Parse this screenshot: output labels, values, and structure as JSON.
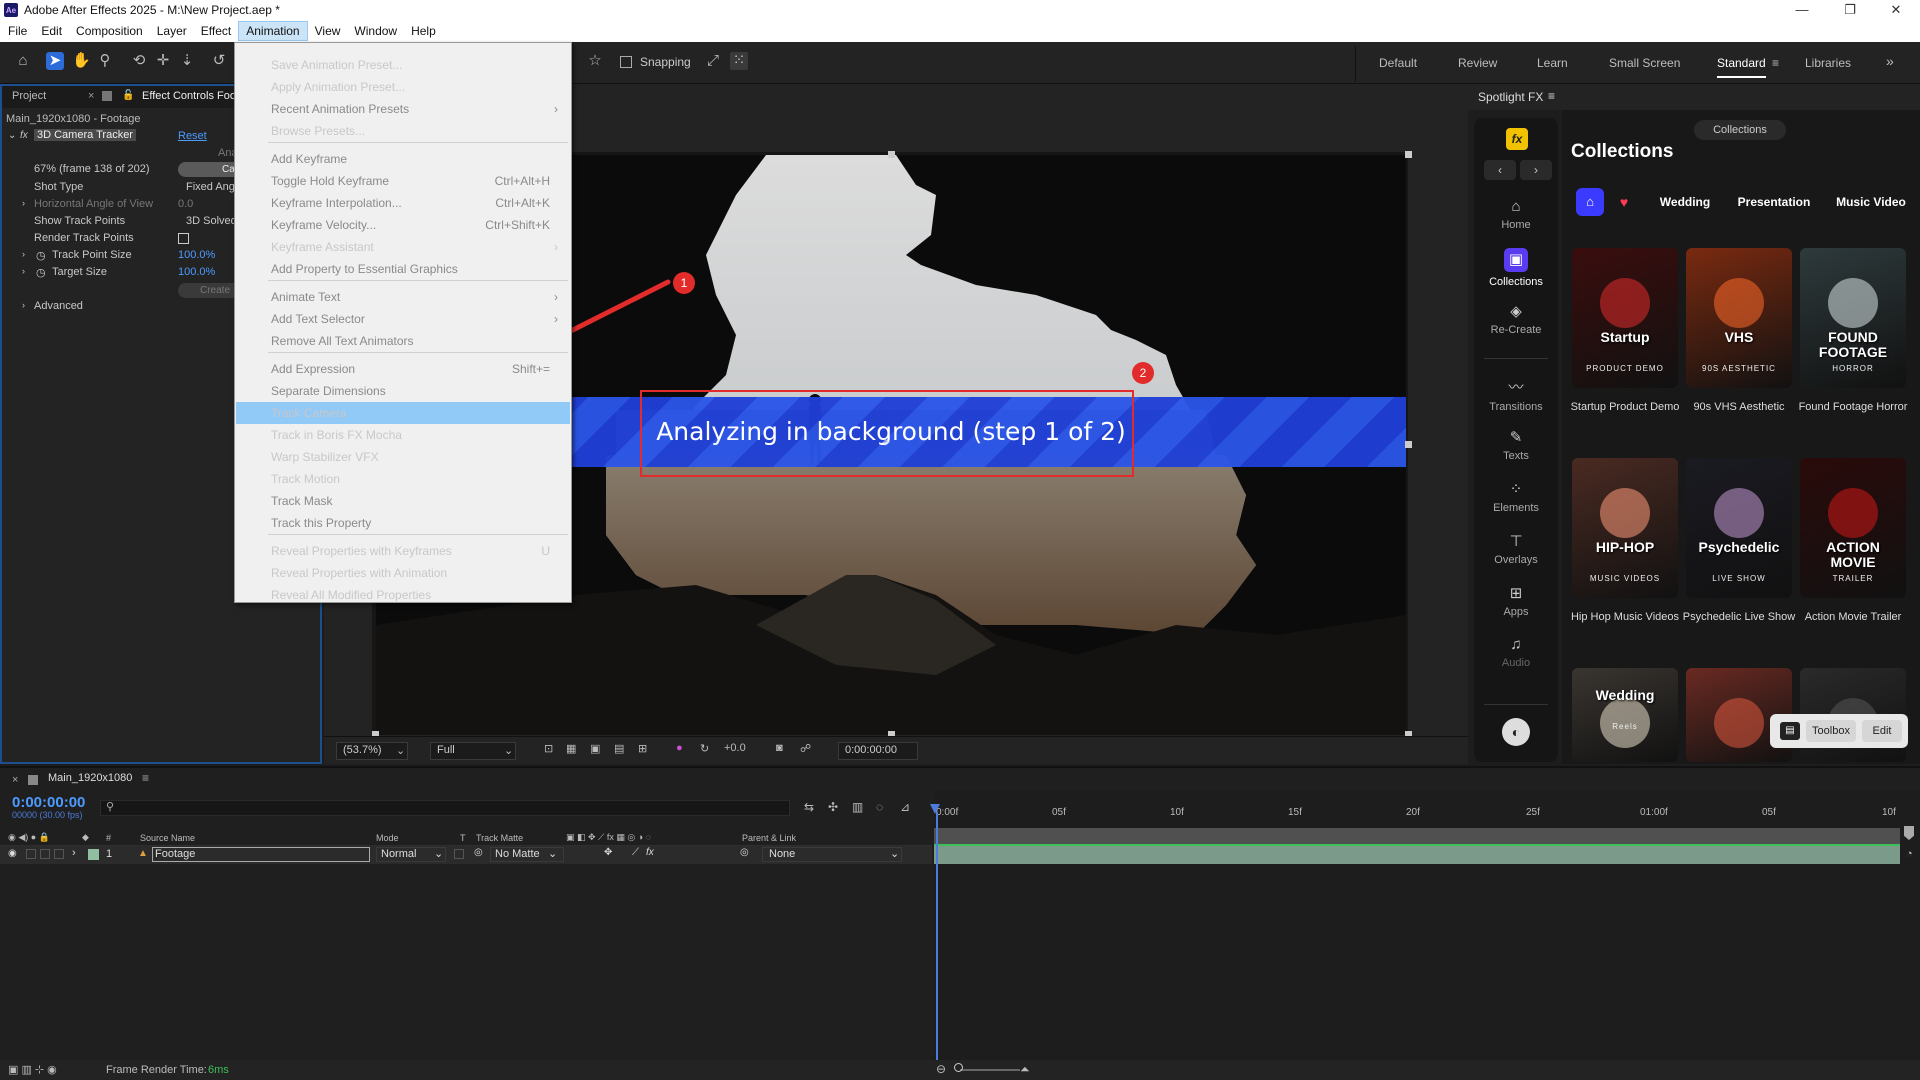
{
  "title_bar": {
    "logo": "Ae",
    "title": "Adobe After Effects 2025 - M:\\New Project.aep *",
    "minimize": "—",
    "maximize": "❐",
    "close": "✕"
  },
  "menubar": [
    "File",
    "Edit",
    "Composition",
    "Layer",
    "Effect",
    "Animation",
    "View",
    "Window",
    "Help"
  ],
  "toolbar": {
    "snapping_label": "Snapping"
  },
  "workspaces": [
    "Default",
    "Review",
    "Learn",
    "Small Screen",
    "Standard",
    "Libraries"
  ],
  "active_workspace": "Standard",
  "left_panel": {
    "tab_project": "Project",
    "tab_effect_controls": "Effect Controls Foot",
    "comp_layer": "Main_1920x1080 - Footage",
    "effect_name": "3D Camera Tracker",
    "reset_label": "Reset",
    "analyze_partial": "Ana",
    "cancel_partial": "Ca",
    "status_line": "67% (frame 138 of 202)",
    "shot_type_label": "Shot Type",
    "shot_type_value": "Fixed Ang",
    "hfov_label": "Horizontal Angle of View",
    "hfov_value": "0.0",
    "show_track_label": "Show Track Points",
    "show_track_value": "3D Solved",
    "render_track_label": "Render Track Points",
    "track_point_size_label": "Track Point Size",
    "track_point_size_value": "100.0%",
    "target_size_label": "Target Size",
    "target_size_value": "100.0%",
    "create_partial": "Create",
    "advanced_label": "Advanced"
  },
  "animation_menu": {
    "items": [
      {
        "label": "Save Animation Preset...",
        "disabled": false
      },
      {
        "label": "Apply Animation Preset...",
        "disabled": false
      },
      {
        "label": "Recent Animation Presets",
        "disabled": true,
        "submenu": true
      },
      {
        "label": "Browse Presets...",
        "disabled": false
      },
      {
        "label": "Add Keyframe",
        "disabled": true
      },
      {
        "label": "Toggle Hold Keyframe",
        "disabled": true,
        "shortcut": "Ctrl+Alt+H"
      },
      {
        "label": "Keyframe Interpolation...",
        "disabled": true,
        "shortcut": "Ctrl+Alt+K"
      },
      {
        "label": "Keyframe Velocity...",
        "disabled": true,
        "shortcut": "Ctrl+Shift+K"
      },
      {
        "label": "Keyframe Assistant",
        "disabled": false,
        "submenu": true
      },
      {
        "label": "Add Property to Essential Graphics",
        "disabled": true
      },
      {
        "label": "Animate Text",
        "disabled": true,
        "submenu": true
      },
      {
        "label": "Add Text Selector",
        "disabled": true,
        "submenu": true
      },
      {
        "label": "Remove All Text Animators",
        "disabled": true
      },
      {
        "label": "Add Expression",
        "disabled": true,
        "shortcut": "Shift+="
      },
      {
        "label": "Separate Dimensions",
        "disabled": true
      },
      {
        "label": "Track Camera",
        "disabled": false,
        "highlighted": true
      },
      {
        "label": "Track in Boris FX Mocha",
        "disabled": false
      },
      {
        "label": "Warp Stabilizer VFX",
        "disabled": false
      },
      {
        "label": "Track Motion",
        "disabled": false
      },
      {
        "label": "Track Mask",
        "disabled": true
      },
      {
        "label": "Track this Property",
        "disabled": true
      },
      {
        "label": "Reveal Properties with Keyframes",
        "disabled": false,
        "shortcut": "U"
      },
      {
        "label": "Reveal Properties with Animation",
        "disabled": false
      },
      {
        "label": "Reveal All Modified Properties",
        "disabled": false
      }
    ]
  },
  "viewer": {
    "banner_text": "Analyzing in background (step 1 of 2)",
    "zoom": "(53.7%)",
    "resolution": "Full",
    "exposure": "+0.0",
    "timecode": "0:00:00:00"
  },
  "annotations": [
    "1",
    "2"
  ],
  "spotlight": {
    "panel_title": "Spotlight FX",
    "fx_logo": "fx",
    "collections_tab": "Collections",
    "heading": "Collections",
    "sidebar": [
      {
        "label": "Home",
        "icon": "home-icon"
      },
      {
        "label": "Collections",
        "icon": "collections-icon",
        "active": true
      },
      {
        "label": "Re-Create",
        "icon": "layers-icon"
      },
      {
        "label": "Transitions",
        "icon": "transitions-icon"
      },
      {
        "label": "Texts",
        "icon": "pen-icon"
      },
      {
        "label": "Elements",
        "icon": "grid-icon"
      },
      {
        "label": "Overlays",
        "icon": "overlays-icon"
      },
      {
        "label": "Apps",
        "icon": "apps-icon"
      },
      {
        "label": "Audio",
        "icon": "music-icon"
      }
    ],
    "filters": [
      "Wedding",
      "Presentation",
      "Music Video"
    ],
    "cards": [
      {
        "label": "Startup Product Demo",
        "thumb_text": "Startup",
        "thumb_sub": "PRODUCT DEMO",
        "bg": "#3a0d0d",
        "accent": "#e02b2b"
      },
      {
        "label": "90s VHS Aesthetic",
        "thumb_text": "VHS",
        "thumb_sub": "90S AESTHETIC",
        "bg": "#7a2a10",
        "accent": "#ff6a2a"
      },
      {
        "label": "Found Footage Horror",
        "thumb_text": "FOUND FOOTAGE",
        "thumb_sub": "HORROR",
        "bg": "#2e3a3c",
        "accent": "#d9e4e4"
      },
      {
        "label": "Hip Hop Music Videos",
        "thumb_text": "HIP-HOP",
        "thumb_sub": "MUSIC VIDEOS",
        "bg": "#4a2a22",
        "accent": "#ff9a7a"
      },
      {
        "label": "Psychedelic Live Show",
        "thumb_text": "Psychedelic",
        "thumb_sub": "LIVE SHOW",
        "bg": "#1a1a22",
        "accent": "#c79ad6"
      },
      {
        "label": "Action Movie Trailer",
        "thumb_text": "ACTION MOVIE",
        "thumb_sub": "TRAILER",
        "bg": "#2a0a0a",
        "accent": "#d01818"
      },
      {
        "label": "",
        "thumb_text": "Wedding",
        "thumb_sub": "Reels",
        "bg": "#3a3530",
        "accent": "#e8dcc8"
      },
      {
        "label": "",
        "thumb_text": "",
        "thumb_sub": "",
        "bg": "#6a2a22",
        "accent": "#e05a40"
      },
      {
        "label": "",
        "thumb_text": "",
        "thumb_sub": "",
        "bg": "#2a2a2a",
        "accent": "#555"
      }
    ],
    "toolbox_label": "Toolbox",
    "edit_label": "Edit"
  },
  "timeline": {
    "comp_tab": "Main_1920x1080",
    "timecode": "0:00:00:00",
    "frame_info": "00000 (30.00 fps)",
    "columns": {
      "source_name": "Source Name",
      "mode": "Mode",
      "t": "T",
      "track_matte": "Track Matte",
      "parent": "Parent & Link",
      "num": "#"
    },
    "layer": {
      "index": "1",
      "name": "Footage",
      "mode": "Normal",
      "track_matte": "No Matte",
      "parent": "None"
    },
    "ruler": [
      "0:00f",
      "05f",
      "10f",
      "15f",
      "20f",
      "25f",
      "01:00f",
      "05f",
      "10f"
    ]
  },
  "status": {
    "render_label": "Frame Render Time:",
    "render_value": "6ms"
  }
}
